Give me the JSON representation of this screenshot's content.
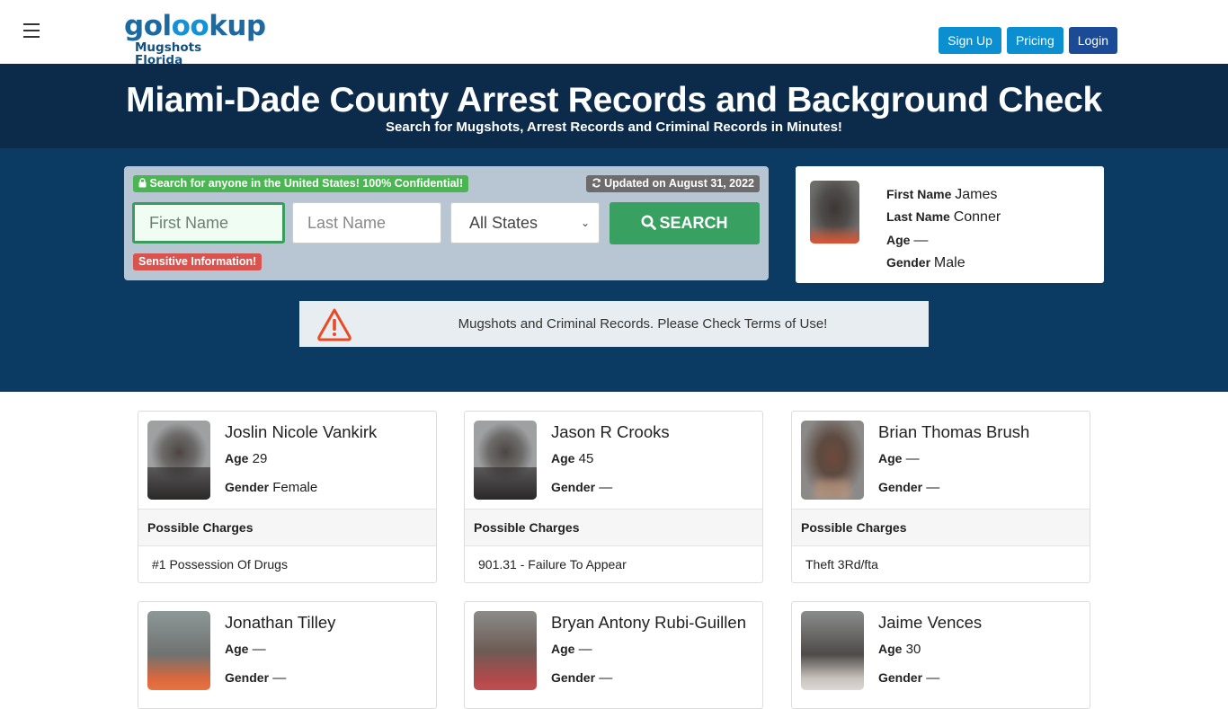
{
  "header": {
    "logo_main_pre": "gol",
    "logo_main_oo": "oo",
    "logo_main_post": "kup",
    "logo_sub": "Mugshots Florida",
    "nav": {
      "signup_label": "Sign Up",
      "pricing_label": "Pricing",
      "login_label": "Login"
    },
    "colors": {
      "signup": "#0b8fd1",
      "pricing": "#0b8fd1",
      "login": "#1b4b96"
    }
  },
  "hero": {
    "title": "Miami-Dade County Arrest Records and Background Check",
    "subtitle": "Search for Mugshots, Arrest Records and Criminal Records in Minutes!"
  },
  "search": {
    "confidential_badge": "Search for anyone in the United States! 100% Confidential!",
    "updated_badge": "Updated on August 31, 2022",
    "first_name_placeholder": "First Name",
    "last_name_placeholder": "Last Name",
    "state_selected": "All States",
    "search_label": "SEARCH",
    "sensitive_badge": "Sensitive Information!"
  },
  "profile": {
    "first_name_label": "First Name",
    "first_name": "James",
    "last_name_label": "Last Name",
    "last_name": "Conner",
    "age_label": "Age",
    "age": "—",
    "gender_label": "Gender",
    "gender": "Male"
  },
  "notice": {
    "text": "Mugshots and Criminal Records. Please Check Terms of Use!"
  },
  "records": [
    {
      "name": "Joslin Nicole Vankirk",
      "age": "29",
      "gender": "Female",
      "charges_label": "Possible Charges",
      "charge": "#1 Possession Of Drugs"
    },
    {
      "name": "Jason R Crooks",
      "age": "45",
      "gender": "—",
      "charges_label": "Possible Charges",
      "charge": "901.31 - Failure To Appear"
    },
    {
      "name": "Brian Thomas Brush",
      "age": "—",
      "gender": "—",
      "charges_label": "Possible Charges",
      "charge": "Theft 3Rd/fta"
    },
    {
      "name": "Jonathan Tilley",
      "age": "—",
      "gender": "—"
    },
    {
      "name": "Bryan Antony Rubi-Guillen",
      "age": "—",
      "gender": "—"
    },
    {
      "name": "Jaime Vences",
      "age": "30",
      "gender": "—"
    }
  ],
  "labels": {
    "age": "Age",
    "gender": "Gender"
  }
}
